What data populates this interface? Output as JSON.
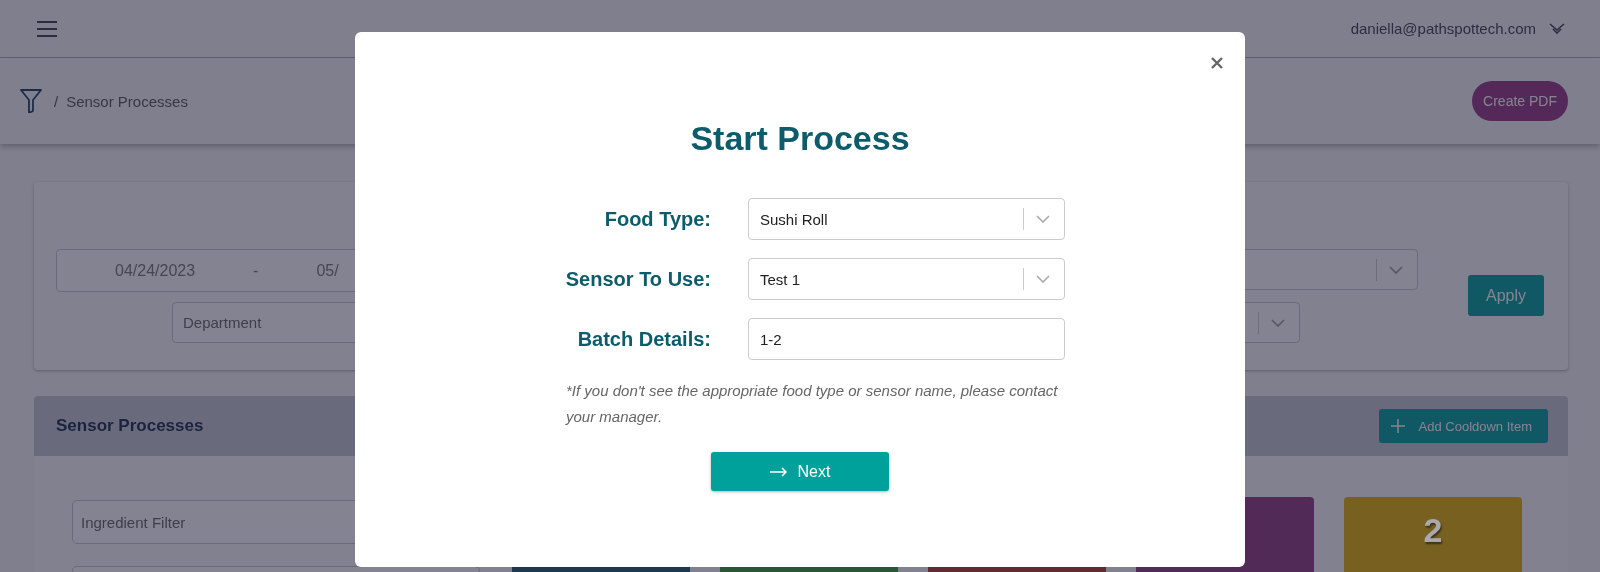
{
  "header": {
    "user_email": "daniella@pathspottech.com"
  },
  "breadcrumb": {
    "separator": "/",
    "current": "Sensor Processes"
  },
  "create_pdf_button": "Create PDF",
  "filters": {
    "start_date": "04/24/2023",
    "range_separator": "-",
    "end_date": "05/",
    "department_placeholder": "Department",
    "apply_button": "Apply"
  },
  "sensor_processes": {
    "title": "Sensor Processes",
    "add_button": "Add Cooldown Item",
    "ingredient_filter_placeholder": "Ingredient Filter",
    "tiles": [
      {
        "color": "#1c3950"
      },
      {
        "color": "#265838"
      },
      {
        "color": "#642a34"
      },
      {
        "color": "#522a57"
      },
      {
        "color": "#786021",
        "count": "2"
      }
    ]
  },
  "modal": {
    "title": "Start Process",
    "fields": [
      {
        "kind": "select",
        "label": "Food Type:",
        "value": "Sushi Roll"
      },
      {
        "kind": "select",
        "label": "Sensor To Use:",
        "value": "Test 1"
      },
      {
        "kind": "text",
        "label": "Batch Details:",
        "value": "1-2"
      }
    ],
    "note": "*If you don't see the appropriate food type or sensor name, please contact your manager.",
    "next_button": "Next"
  }
}
